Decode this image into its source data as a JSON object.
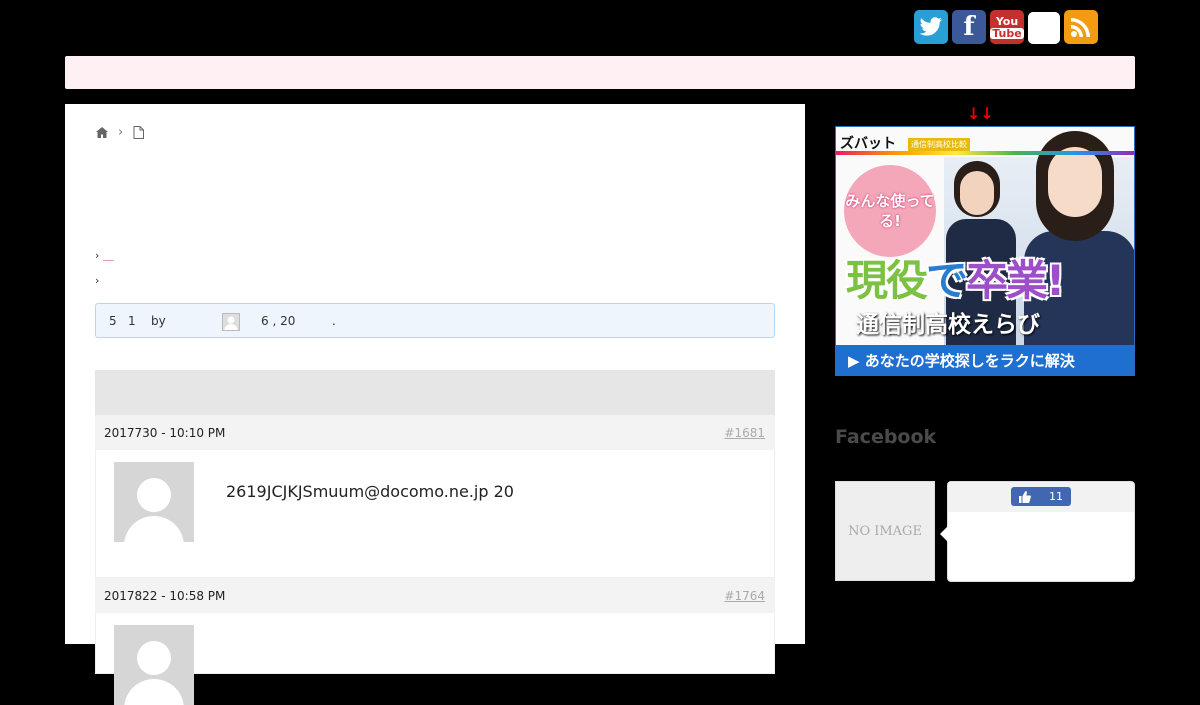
{
  "social": {
    "twitter_glyph": "t",
    "facebook_glyph": "f",
    "youtube_you": "You",
    "youtube_tube": "Tube",
    "rss_glyph": ")))"
  },
  "breadcrumb": {
    "separator": "›"
  },
  "topic": {
    "line1_prefix": "› ",
    "line1_link": "＿",
    "line2": "›"
  },
  "info": {
    "a": "5",
    "b": "1",
    "by": "by",
    "c": "6 , 20",
    "d": "."
  },
  "replies": [
    {
      "date": "2017730 - 10:10 PM",
      "num": "#1681",
      "text": "2619JCJKJSmuum@docomo.ne.jp 20"
    },
    {
      "date": "2017822 - 10:58 PM",
      "num": "#1764",
      "text": ""
    }
  ],
  "sidebar": {
    "arrows": "↓↓",
    "banner": {
      "logo": "ズバット",
      "logo_sub": "通信制高校比較",
      "badge": "みんな使ってる!",
      "big_1": "現役",
      "big_2": "で",
      "big_3": "卒業",
      "big_4": "!",
      "sub": "通信制高校えらび",
      "cta": "▶ あなたの学校探しをラクに解決"
    },
    "facebook_title": "Facebook",
    "no_image": "NO IMAGE",
    "like_count": "11"
  }
}
